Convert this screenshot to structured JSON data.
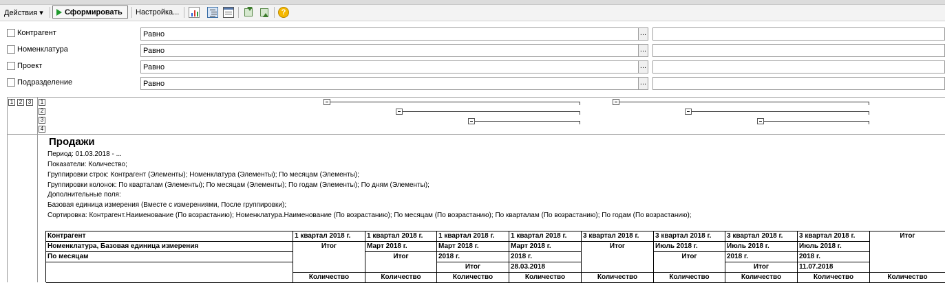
{
  "toolbar": {
    "actions_label": "Действия",
    "generate_label": "Сформировать",
    "settings_label": "Настройка..."
  },
  "filters": [
    {
      "label": "Контрагент",
      "condition": "Равно",
      "value": ""
    },
    {
      "label": "Номенклатура",
      "condition": "Равно",
      "value": ""
    },
    {
      "label": "Проект",
      "condition": "Равно",
      "value": ""
    },
    {
      "label": "Подразделение",
      "condition": "Равно",
      "value": ""
    }
  ],
  "dots_label": "...",
  "row_levels": [
    "1",
    "2",
    "3"
  ],
  "col_levels": [
    "1",
    "2",
    "3",
    "4"
  ],
  "report": {
    "title": "Продажи",
    "period": "Период: 01.03.2018 - ...",
    "indicators": "Показатели: Количество;",
    "row_groups": "Группировки строк: Контрагент (Элементы); Номенклатура (Элементы); По месяцам (Элементы);",
    "col_groups": "Группировки колонок: По кварталам (Элементы); По месяцам (Элементы); По годам (Элементы); По дням (Элементы);",
    "extra_fields": "Дополнительные поля:",
    "base_unit": "Базовая единица измерения (Вместе с измерениями, После группировки);",
    "sorting": "Сортировка: Контрагент.Наименование (По возрастанию); Номенклатура.Наименование (По возрастанию); По месяцам (По возрастанию); По кварталам (По возрастанию); По годам (По возрастанию);"
  },
  "table": {
    "row_headers": [
      "Контрагент",
      "Номенклатура, Базовая единица измерения",
      "По месяцам"
    ],
    "columns": [
      {
        "h1": "1 квартал 2018 г.",
        "h2": "Итог",
        "h3": "",
        "h4": "",
        "measure": "Количество"
      },
      {
        "h1": "1 квартал 2018 г.",
        "h2": "Март 2018 г.",
        "h3": "Итог",
        "h4": "",
        "measure": "Количество"
      },
      {
        "h1": "1 квартал 2018 г.",
        "h2": "Март 2018 г.",
        "h3": "2018 г.",
        "h4": "Итог",
        "measure": "Количество"
      },
      {
        "h1": "1 квартал 2018 г.",
        "h2": "Март 2018 г.",
        "h3": "2018 г.",
        "h4": "28.03.2018",
        "measure": "Количество"
      },
      {
        "h1": "3 квартал 2018 г.",
        "h2": "Итог",
        "h3": "",
        "h4": "",
        "measure": "Количество"
      },
      {
        "h1": "3 квартал 2018 г.",
        "h2": "Июль 2018 г.",
        "h3": "Итог",
        "h4": "",
        "measure": "Количество"
      },
      {
        "h1": "3 квартал 2018 г.",
        "h2": "Июль 2018 г.",
        "h3": "2018 г.",
        "h4": "Итог",
        "measure": "Количество"
      },
      {
        "h1": "3 квартал 2018 г.",
        "h2": "Июль 2018 г.",
        "h3": "2018 г.",
        "h4": "11.07.2018",
        "measure": "Количество"
      },
      {
        "h1": "Итог",
        "h2": "",
        "h3": "",
        "h4": "",
        "measure": "Количество"
      }
    ]
  }
}
